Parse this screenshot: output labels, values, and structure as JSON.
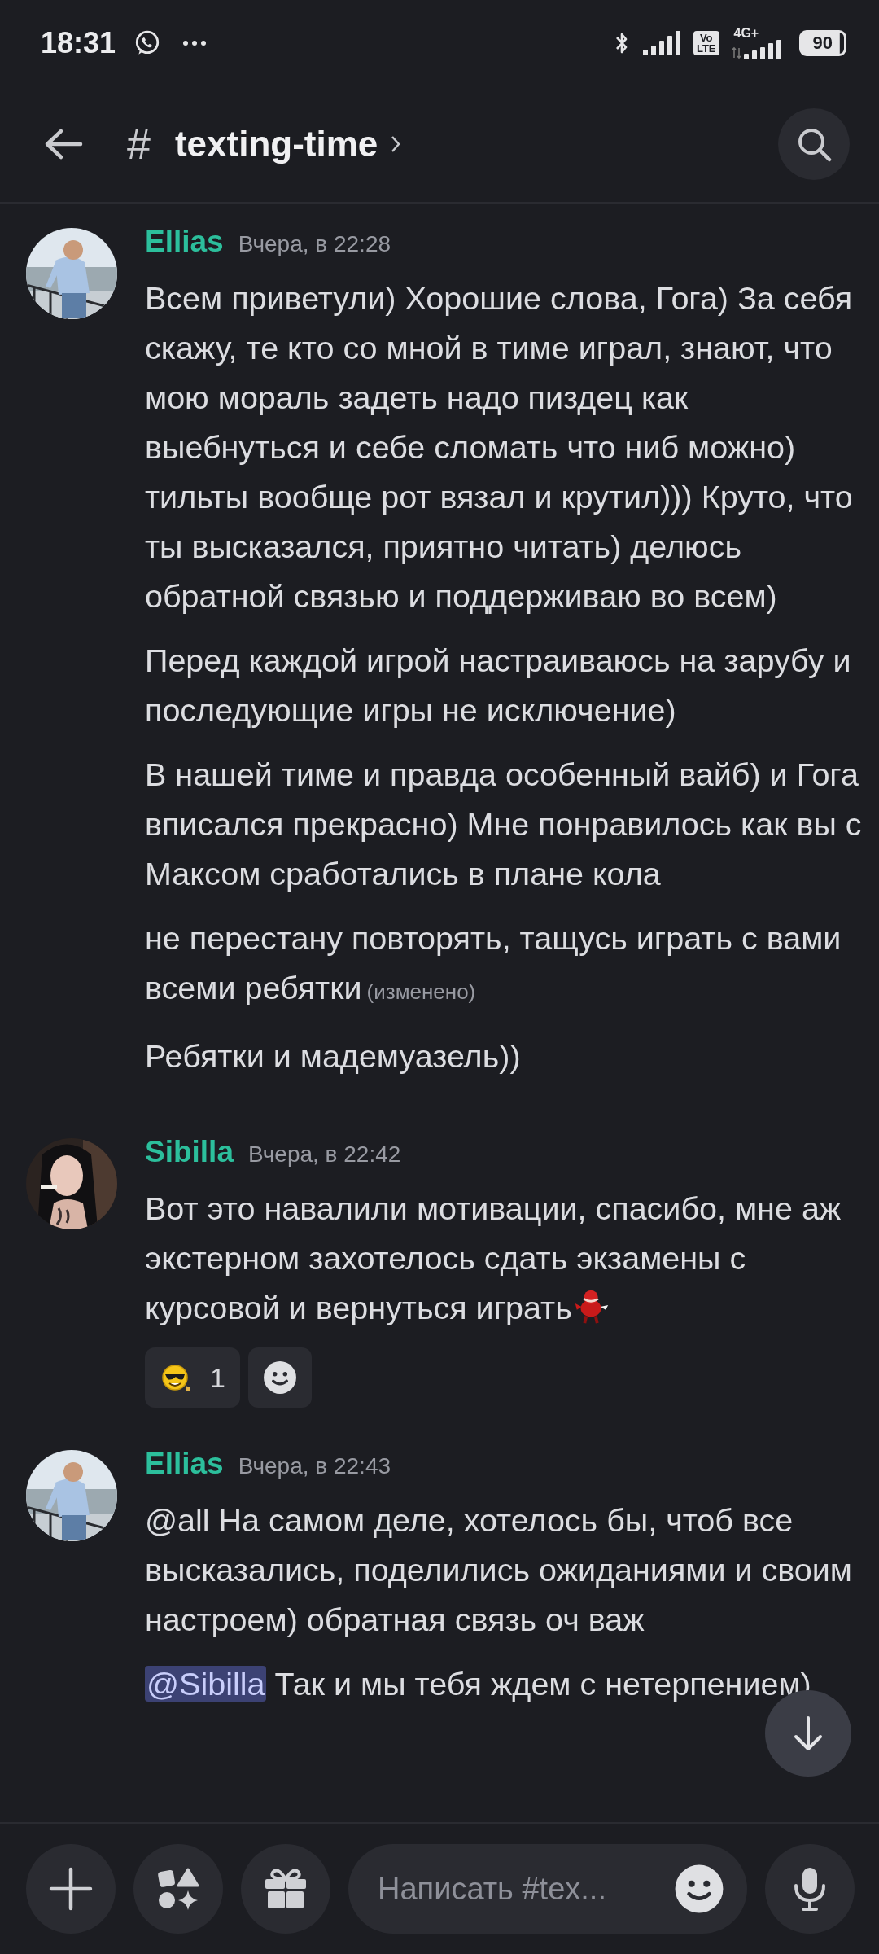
{
  "status_bar": {
    "time": "18:31",
    "network_badge": [
      "Vo",
      "LTE"
    ],
    "network_type": "4G+",
    "battery": "90"
  },
  "header": {
    "channel_symbol": "#",
    "title": "texting-time"
  },
  "messages": [
    {
      "author": "Ellias",
      "avatar": {
        "kind": "picture"
      },
      "timestamp": "Вчера, в 22:28",
      "paragraphs": [
        {
          "text": "Всем приветули) Хорошие слова, Гога) За себя скажу, те кто со мной в тиме играл, знают, что мою мораль задеть надо пиздец как выебнуться и себе сломать что ниб можно) тильты вообще рот вязал и крутил))) Круто, что ты высказался, приятно читать) делюсь обратной связью и поддерживаю во всем)"
        },
        {
          "text": "Перед каждой игрой настраиваюсь на зарубу и последующие игры не исключение)"
        },
        {
          "text": "В нашей тиме и правда особенный вайб) и Гога вписался прекрасно) Мне понравилось как вы с Максом сработались в плане кола"
        },
        {
          "text": "не перестану повторять, тащусь играть с вами всеми ребятки",
          "edited": "(изменено)"
        },
        {
          "text": "Ребятки и мадемуазель))"
        }
      ]
    },
    {
      "author": "Sibilla",
      "avatar": {
        "kind": "picture"
      },
      "timestamp": "Вчера, в 22:42",
      "paragraphs": [
        {
          "text": "Вот это навалили мотивации, спасибо, мне аж экстерном захотелось сдать экзамены с курсовой и вернуться играть",
          "custom_emoji": true
        }
      ],
      "reactions": [
        {
          "count": "1"
        }
      ]
    },
    {
      "author": "Ellias",
      "avatar": {
        "kind": "picture"
      },
      "timestamp": "Вчера, в 22:43",
      "paragraphs": [
        {
          "text": "@all На самом деле, хотелось бы, чтоб все высказались, поделились ожиданиями и своим настроем) обратная связь оч важ"
        },
        {
          "mention": "@Sibilla",
          "text": "Так и мы тебя ждем с нетерпением)"
        }
      ]
    }
  ],
  "composer": {
    "placeholder": "Написать #tex..."
  }
}
